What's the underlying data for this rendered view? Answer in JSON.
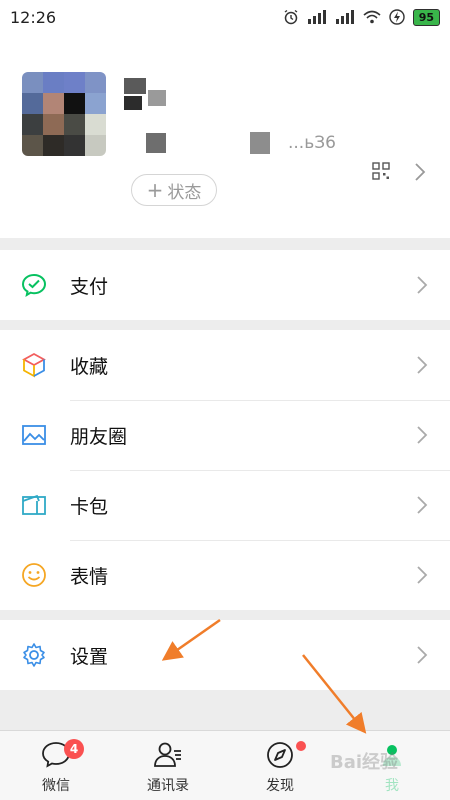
{
  "status_bar": {
    "time": "12:26",
    "battery": "95"
  },
  "profile": {
    "id_suffix": "...ьЗ6",
    "status_button": {
      "plus": "+",
      "label": "状态"
    }
  },
  "menu": {
    "pay": {
      "label": "支付",
      "icon": "wechat-pay-icon"
    },
    "favorites": {
      "label": "收藏",
      "icon": "cube-icon"
    },
    "moments": {
      "label": "朋友圈",
      "icon": "image-icon"
    },
    "cards": {
      "label": "卡包",
      "icon": "wallet-icon"
    },
    "stickers": {
      "label": "表情",
      "icon": "smiley-icon"
    },
    "settings": {
      "label": "设置",
      "icon": "gear-icon"
    }
  },
  "tabbar": {
    "chats": {
      "label": "微信",
      "badge": "4"
    },
    "contacts": {
      "label": "通讯录"
    },
    "discover": {
      "label": "发现"
    },
    "me": {
      "label": "我"
    }
  },
  "watermark": {
    "text": "Bai经验"
  },
  "colors": {
    "accent": "#07c160",
    "badge": "#fa5151",
    "annotation_arrow": "#f07d2a"
  }
}
